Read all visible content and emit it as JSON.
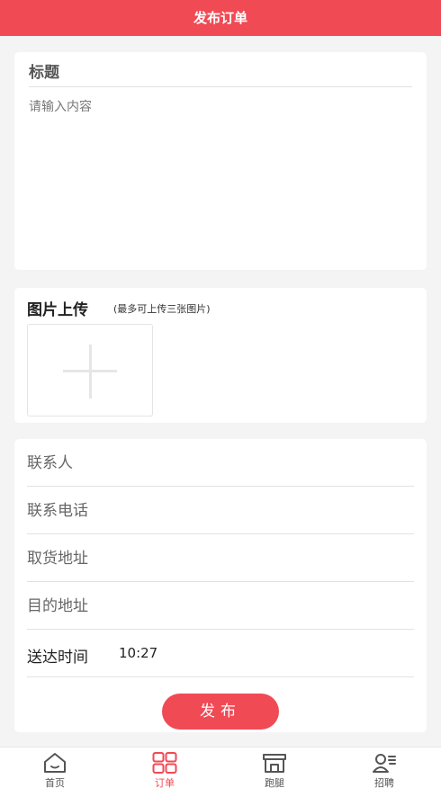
{
  "header": {
    "title": "发布订单"
  },
  "content_card": {
    "title": "标题",
    "placeholder": "请输入内容"
  },
  "upload_card": {
    "title": "图片上传",
    "hint": "(最多可上传三张图片)"
  },
  "form": {
    "contact_placeholder": "联系人",
    "phone_placeholder": "联系电话",
    "pickup_placeholder": "取货地址",
    "destination_placeholder": "目的地址",
    "delivery_time_label": "送达时间",
    "delivery_time_value": "10:27",
    "publish_label": "发布"
  },
  "tabbar": {
    "items": [
      {
        "label": "首页",
        "icon": "home-icon"
      },
      {
        "label": "订单",
        "icon": "grid-icon"
      },
      {
        "label": "跑腿",
        "icon": "store-icon"
      },
      {
        "label": "招聘",
        "icon": "user-list-icon"
      }
    ],
    "active_index": 1
  },
  "colors": {
    "accent": "#f04a55",
    "background": "#f4f4f4"
  }
}
